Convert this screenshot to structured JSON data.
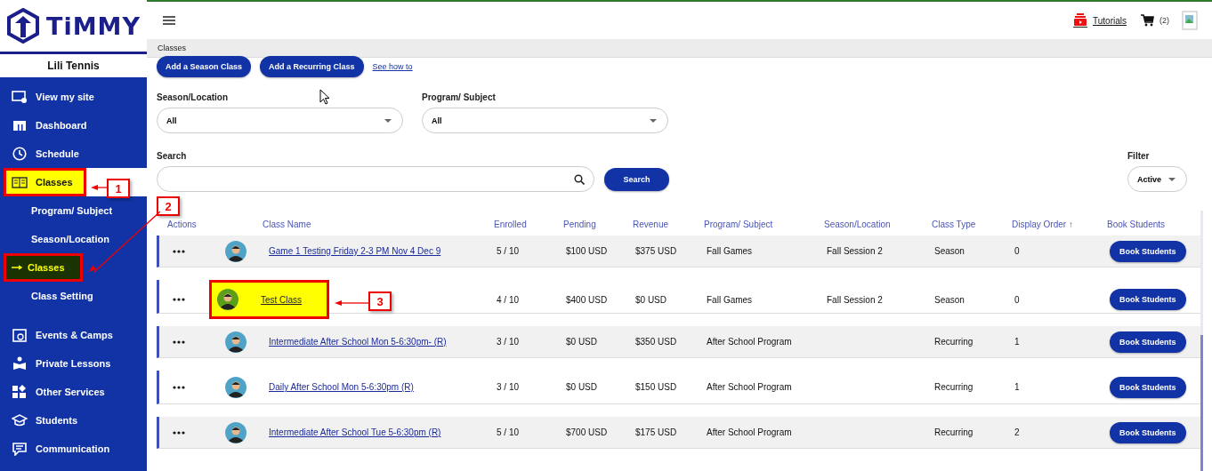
{
  "logo": {
    "text": "TiMMY"
  },
  "account": {
    "name": "Lili Tennis"
  },
  "sidebar": {
    "items": [
      {
        "label": "View my site",
        "selected": false,
        "highlighted": false
      },
      {
        "label": "Dashboard",
        "selected": false,
        "highlighted": false
      },
      {
        "label": "Schedule",
        "selected": false,
        "highlighted": false
      },
      {
        "label": "Classes",
        "selected": true,
        "highlighted": true,
        "children": [
          {
            "label": "Program/ Subject",
            "selected": false,
            "highlighted": false
          },
          {
            "label": "Season/Location",
            "selected": false,
            "highlighted": false
          },
          {
            "label": "Classes",
            "selected": true,
            "highlighted": true
          },
          {
            "label": "Class Setting",
            "selected": false,
            "highlighted": false
          }
        ]
      },
      {
        "label": "Events & Camps",
        "selected": false,
        "highlighted": false
      },
      {
        "label": "Private Lessons",
        "selected": false,
        "highlighted": false
      },
      {
        "label": "Other Services",
        "selected": false,
        "highlighted": false
      },
      {
        "label": "Students",
        "selected": false,
        "highlighted": false
      },
      {
        "label": "Communication",
        "selected": false,
        "highlighted": false
      }
    ]
  },
  "header": {
    "tutorials": "Tutorials",
    "cart_count": "(2)"
  },
  "breadcrumb": "Classes",
  "actions": {
    "buttons": [
      "Add a Season Class",
      "Add a Recurring Class"
    ],
    "link": "See how to"
  },
  "filters": [
    {
      "label": "Season/Location",
      "value": "All"
    },
    {
      "label": "Program/ Subject",
      "value": "All"
    }
  ],
  "search": {
    "label": "Search",
    "button": "Search"
  },
  "status_filter": {
    "label": "Filter",
    "value": "Active"
  },
  "table": {
    "columns": [
      "Actions",
      "Class Name",
      "Enrolled",
      "Pending",
      "Revenue",
      "Program/ Subject",
      "Season/Location",
      "Class Type",
      "Display Order ↑",
      "Book Students"
    ],
    "rows": [
      {
        "name": "Game 1 Testing Friday 2-3 PM Nov 4 Dec 9",
        "enrolled": "5 / 10",
        "pending": "$100 USD",
        "revenue": "$375 USD",
        "program": "Fall Games",
        "season": "Fall Session 2",
        "type": "Season",
        "order": "0",
        "button": "Book Students",
        "highlighted": false
      },
      {
        "name": "Test Class",
        "enrolled": "4 / 10",
        "pending": "$400 USD",
        "revenue": "$0 USD",
        "program": "Fall Games",
        "season": "Fall Session 2",
        "type": "Season",
        "order": "0",
        "button": "Book Students",
        "highlighted": true
      },
      {
        "name": "Intermediate After School Mon 5-6:30pm- (R)",
        "enrolled": "3 / 10",
        "pending": "$0 USD",
        "revenue": "$350 USD",
        "program": "After School Program",
        "type": "Recurring",
        "order": "1",
        "button": "Book Students",
        "highlighted": false
      },
      {
        "name": "Daily After School Mon 5-6:30pm (R)",
        "enrolled": "3 / 10",
        "pending": "$0 USD",
        "revenue": "$150 USD",
        "program": "After School Program",
        "type": "Recurring",
        "order": "1",
        "button": "Book Students",
        "highlighted": false
      },
      {
        "name": "Intermediate After School Tue 5-6:30pm (R)",
        "enrolled": "5 / 10",
        "pending": "$700 USD",
        "revenue": "$175 USD",
        "program": "After School Program",
        "type": "Recurring",
        "order": "2",
        "button": "Book Students",
        "highlighted": false
      }
    ]
  },
  "callouts": [
    {
      "number": "1"
    },
    {
      "number": "2"
    },
    {
      "number": "3"
    }
  ]
}
